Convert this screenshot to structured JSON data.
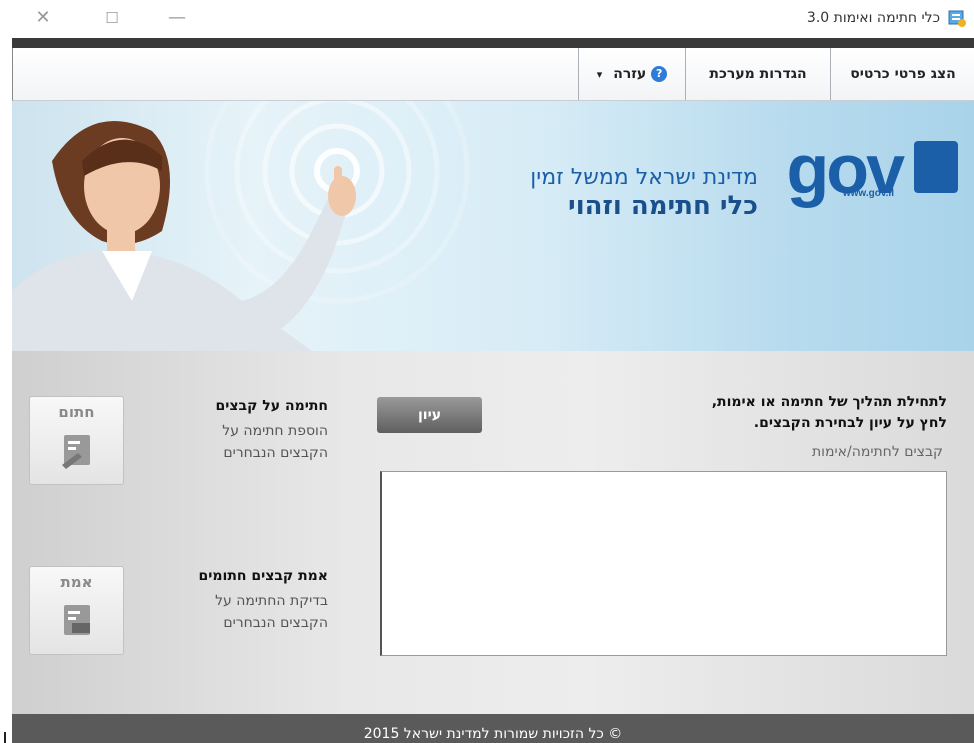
{
  "window": {
    "title": "כלי חתימה ואימות 3.0",
    "close_glyph": "✕",
    "maximize_glyph": "☐",
    "minimize_glyph": "—"
  },
  "menu": {
    "show_card_details": "הצג פרטי כרטיס",
    "system_settings": "הגדרות מערכת",
    "help": "עזרה",
    "help_arrow": "▾"
  },
  "banner": {
    "logo_text": "gov",
    "logo_url": "www.gov.il",
    "tagline": "מדינת ישראל ממשל זמין",
    "product_name": "כלי חתימה וזהוי"
  },
  "sign": {
    "button_label": "חתום",
    "title": "חתימה על קבצים",
    "desc_line1": "הוספת חתימה על",
    "desc_line2": "הקבצים הנבחרים"
  },
  "verify": {
    "button_label": "אמת",
    "title": "אמת קבצים חתומים",
    "desc_line1": "בדיקת החתימה על",
    "desc_line2": "הקבצים הנבחרים"
  },
  "browse_label": "עיון",
  "instructions": {
    "line1": "לתחילת תהליך של חתימה או אימות,",
    "line2": "לחץ על עיון לבחירת הקבצים."
  },
  "files_label": "קבצים לחתימה/אימות",
  "footer": "© כל הזכויות שמורות למדינת ישראל 2015",
  "colors": {
    "banner_blue": "#1a5fa8",
    "footer_bg": "#5a5a5a"
  }
}
